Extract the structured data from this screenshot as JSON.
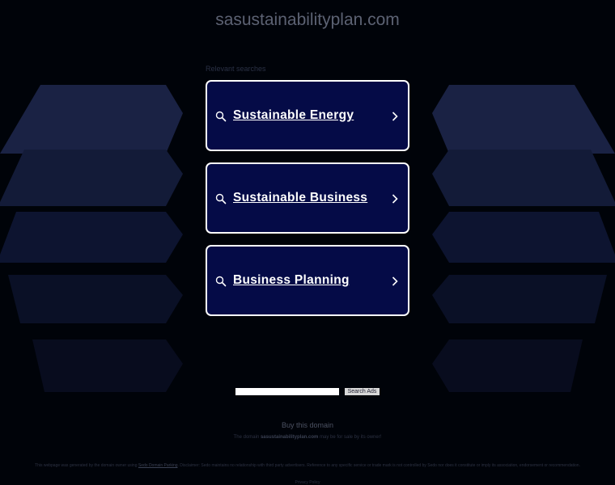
{
  "header": {
    "domain": "sasustainabilityplan.com"
  },
  "relevant": {
    "label": "Relevant searches",
    "items": [
      {
        "label": "Sustainable Energy"
      },
      {
        "label": "Sustainable Business"
      },
      {
        "label": "Business Planning"
      }
    ]
  },
  "search": {
    "button_label": "Search Ads",
    "placeholder": ""
  },
  "footer": {
    "buy_label": "Buy this domain",
    "sale_prefix": "The domain",
    "sale_domain": "sasustainabilityplan.com",
    "sale_suffix": "may be for sale by its owner!",
    "disclaimer_prefix": "This webpage was generated by the domain owner using",
    "disclaimer_link": "Sedo Domain Parking",
    "disclaimer_suffix": ". Disclaimer: Sedo maintains no relationship with third party advertisers. Reference to any specific service or trade mark is not controlled by Sedo nor does it constitute or imply its association, endorsement or recommendation.",
    "privacy_label": "Privacy Policy"
  },
  "colors": {
    "background": "#000309",
    "card_background": "#050b47",
    "card_border": "#ffffff",
    "title_text": "#5c6273"
  }
}
